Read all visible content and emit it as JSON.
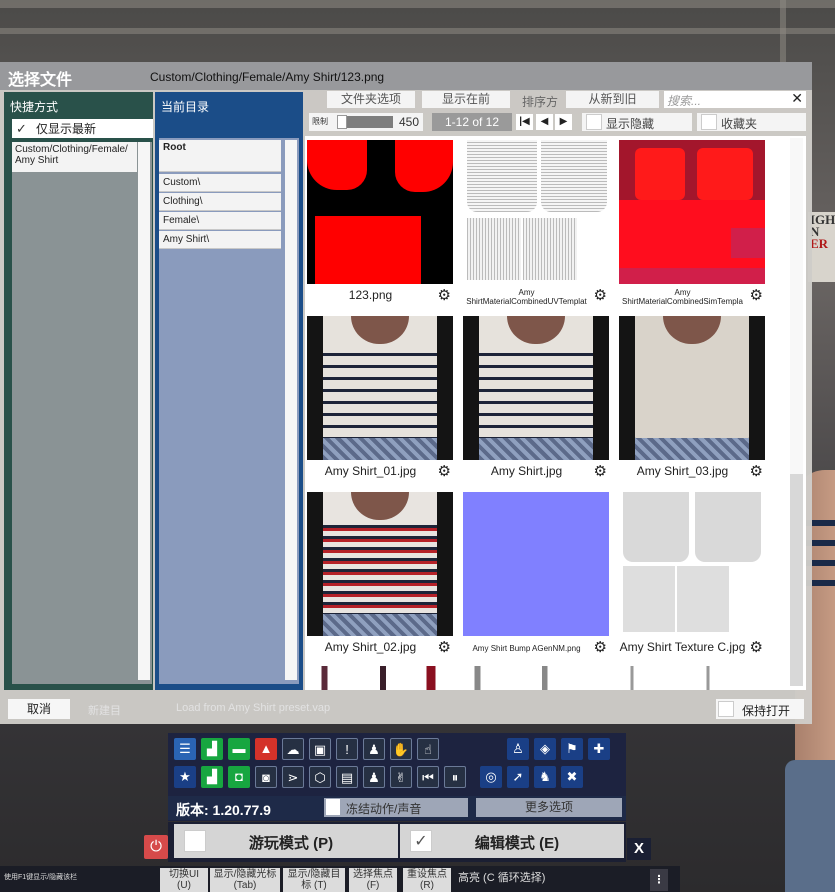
{
  "dialog": {
    "title": "选择文件",
    "path": "Custom/Clothing/Female/Amy Shirt/123.png"
  },
  "shortcuts": {
    "header": "快捷方式",
    "latest_only": "仅显示最新",
    "latest_only_checked": true,
    "items": [
      {
        "label": "Custom/Clothing/Female/\nAmy Shirt"
      }
    ]
  },
  "current_dir": {
    "header": "当前目录",
    "items": [
      {
        "label": "Root"
      },
      {
        "label": "Custom\\"
      },
      {
        "label": "Clothing\\"
      },
      {
        "label": "Female\\"
      },
      {
        "label": "Amy Shirt\\"
      }
    ]
  },
  "toolbar": {
    "folder_options": "文件夹选项",
    "show_first": "显示在前",
    "sort_by": "排序方",
    "sort_value": "从新到旧",
    "search_placeholder": "搜索...",
    "search_clear": "✕",
    "limit_label": "限制",
    "limit_value": "450",
    "limit_fraction": 0.08,
    "page_range": "1-12 of 12",
    "show_hidden": "显示隐藏",
    "favorites": "收藏夹"
  },
  "files": [
    {
      "name": "123.png",
      "small": false,
      "kind": "red-tex"
    },
    {
      "name": "Amy\nShirtMaterialCombinedUVTemplat",
      "small": true,
      "kind": "uv-tex"
    },
    {
      "name": "Amy\nShirtMaterialCombinedSimTempla",
      "small": true,
      "kind": "sim-tex"
    },
    {
      "name": "Amy Shirt_01.jpg",
      "small": false,
      "kind": "photo-stripe"
    },
    {
      "name": "Amy Shirt.jpg",
      "small": false,
      "kind": "photo-stripe"
    },
    {
      "name": "Amy Shirt_03.jpg",
      "small": false,
      "kind": "photo-plain"
    },
    {
      "name": "Amy Shirt_02.jpg",
      "small": false,
      "kind": "photo-stripe-red"
    },
    {
      "name": "Amy Shirt Bump AGenNM.png",
      "small": true,
      "kind": "normal-map"
    },
    {
      "name": "Amy Shirt Texture C.jpg",
      "small": false,
      "kind": "grey-tex"
    }
  ],
  "bottom": {
    "cancel": "取消",
    "select_faded": "新建目",
    "load_faded": "Load from Amy Shirt preset.vap",
    "keep_open": "保持打开"
  },
  "game": {
    "version": "版本: 1.20.77.9",
    "freeze": "冻结动作/声音",
    "more_options": "更多选项",
    "play_mode": "游玩模式 (P)",
    "edit_mode": "编辑模式 (E)",
    "edit_checked": true,
    "close": "X",
    "power": "⏻",
    "icons_row1": [
      "menu-icon",
      "scene-icon",
      "folder-icon",
      "import-icon",
      "cloud-icon",
      "package-icon",
      "alert-icon",
      "person-add-icon",
      "hand-icon",
      "touch-icon",
      "person-icon",
      "unity-icon",
      "flag-icon",
      "plus-icon"
    ],
    "icons_row2": [
      "star-icon",
      "scene-edit-icon",
      "screenshot-folder-icon",
      "camera-icon",
      "share-icon",
      "box-icon",
      "doc-icon",
      "person-settings-icon",
      "person-hand-icon",
      "skip-back-icon",
      "pause-icon",
      "target-icon",
      "cursor-icon",
      "people-icon",
      "tools-icon"
    ]
  },
  "hint": {
    "left": "使用F1键显示/隐藏该栏",
    "buttons": [
      {
        "label": "切换UI\n(U)"
      },
      {
        "label": "显示/隐藏光标\n(Tab)"
      },
      {
        "label": "显示/隐藏目\n标 (T)"
      },
      {
        "label": "选择焦点\n(F)"
      },
      {
        "label": "重设焦点\n(R)"
      }
    ],
    "highlight": "高亮 (C 循环选择)",
    "menu": "⋮"
  }
}
